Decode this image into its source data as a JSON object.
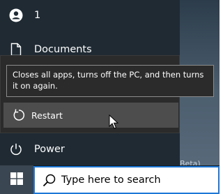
{
  "start_menu": {
    "user": {
      "label": "1",
      "icon": "user-icon"
    },
    "documents": {
      "label": "Documents",
      "icon": "document-icon"
    },
    "power": {
      "label": "Power",
      "icon": "power-icon"
    }
  },
  "power_flyout": {
    "restart": {
      "label": "Restart",
      "icon": "restart-icon"
    }
  },
  "tooltip": {
    "text": "Closes all apps, turns off the PC, and then turns it on again."
  },
  "desktop": {
    "partial_text": "Beta)"
  },
  "taskbar": {
    "start_icon": "windows-logo-icon",
    "search": {
      "placeholder": "Type here to search",
      "icon": "search-icon"
    }
  },
  "colors": {
    "rail_bg": "#1f2a33",
    "flyout_bg": "#2b2b2b",
    "highlight": "#4d4d4d",
    "search_border": "#1e78d6"
  }
}
